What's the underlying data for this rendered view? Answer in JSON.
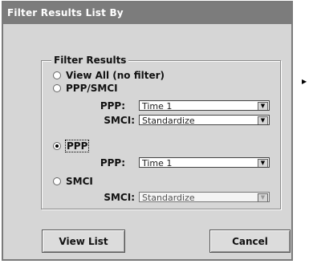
{
  "dialog": {
    "title": "Filter Results List By",
    "group_label": "Filter Results",
    "options": {
      "view_all": {
        "label": "View All (no filter)",
        "checked": false
      },
      "ppp_smci": {
        "label": "PPP/SMCI",
        "checked": false
      },
      "ppp": {
        "label": "PPP",
        "checked": true
      },
      "smci": {
        "label": "SMCI",
        "checked": false
      }
    },
    "fields": {
      "ppp_smci_ppp_label": "PPP:",
      "ppp_smci_ppp_value": "Time 1",
      "ppp_smci_smci_label": "SMCI:",
      "ppp_smci_smci_value": "Standardize",
      "ppp_ppp_label": "PPP:",
      "ppp_ppp_value": "Time 1",
      "smci_smci_label": "SMCI:",
      "smci_smci_value": "Standardize"
    },
    "buttons": {
      "view_list": "View List",
      "cancel": "Cancel"
    }
  }
}
